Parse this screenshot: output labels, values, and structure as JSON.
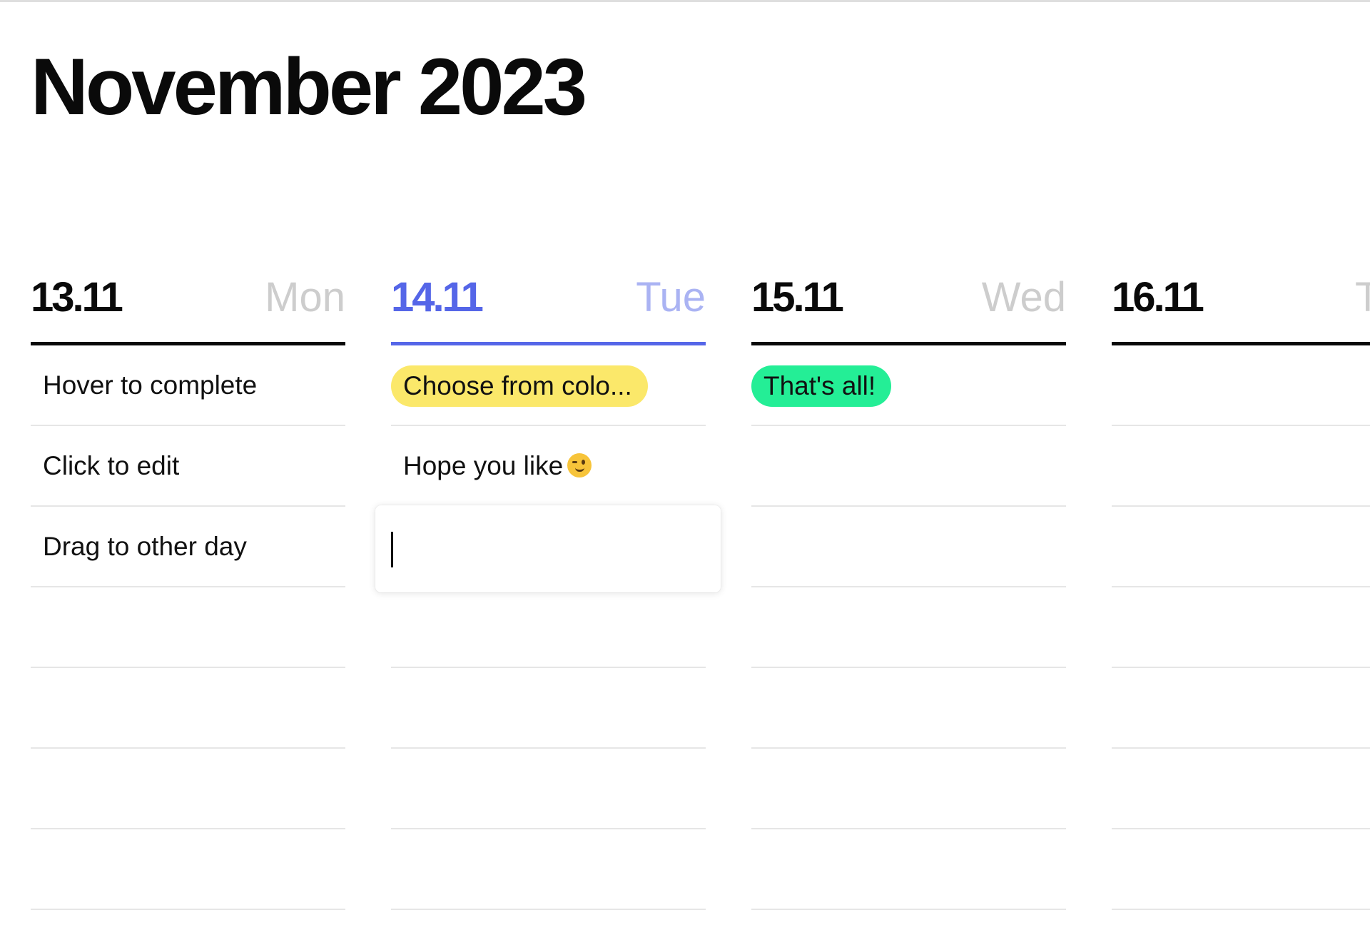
{
  "header": {
    "title": "November 2023"
  },
  "colors": {
    "today_accent": "#5566e8",
    "today_dayname": "#aab3f3",
    "pill_yellow": "#fbe86a",
    "pill_green": "#24ee96",
    "header_rule": "#0a0a0a",
    "slot_rule": "#e6e6e6"
  },
  "days": [
    {
      "date": "13.11",
      "name": "Mon",
      "today": false,
      "tasks": [
        {
          "text": "Hover to complete"
        },
        {
          "text": "Click to edit"
        },
        {
          "text": "Drag to other day"
        }
      ]
    },
    {
      "date": "14.11",
      "name": "Tue",
      "today": true,
      "tasks": [
        {
          "text": "Choose from colo...",
          "color": "yellow"
        },
        {
          "text": "Hope you like",
          "emoji": "winking-face-icon"
        }
      ],
      "editing_input": {
        "value": "",
        "placeholder": ""
      }
    },
    {
      "date": "15.11",
      "name": "Wed",
      "today": false,
      "tasks": [
        {
          "text": "That's all!",
          "color": "green"
        }
      ]
    },
    {
      "date": "16.11",
      "name": "Thu",
      "today": false,
      "tasks": []
    }
  ]
}
